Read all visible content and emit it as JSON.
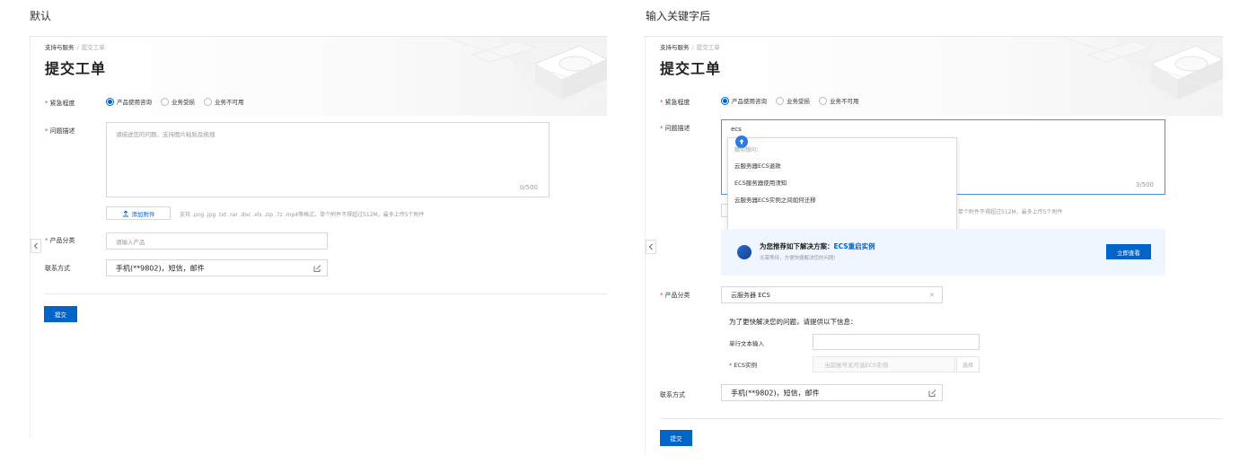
{
  "captions": {
    "left": "默认",
    "right": "输入关键字后"
  },
  "common": {
    "breadcrumb": {
      "root": "支持与服务",
      "sep": "/",
      "current": "提交工单"
    },
    "title": "提交工单",
    "urgency": {
      "label": "紧急程度",
      "options": [
        "产品使用咨询",
        "业务受损",
        "业务不可用"
      ],
      "selected": 0
    },
    "description": {
      "label": "问题描述"
    },
    "attachment": {
      "button_label": "添加附件",
      "hint": "支持 .png .jpg .txt .rar .doc .xls .zip .7z .mp4等格式，单个附件不得超过512M，最多上传5个附件"
    },
    "product": {
      "label": "产品分类",
      "placeholder": "请输入产品"
    },
    "contact": {
      "label": "联系方式",
      "value": "手机(**9802)，短信，邮件"
    },
    "submit_label": "提交",
    "colors": {
      "accent": "#0064c8",
      "required": "#e34",
      "border": "#d7d7d7"
    }
  },
  "left_panel": {
    "description_placeholder": "请描述您的问题，支持图片粘贴及拖拽",
    "description_count": "0/500"
  },
  "right_panel": {
    "description_value": "ecs",
    "description_count": "3/500",
    "attach_hint_visible": "单个附件不得超过512M，最多上传5个附件",
    "dropdown": {
      "group_label": "猜你想问：",
      "items": [
        "云服务器ECS退款",
        "ECS服务器使用须知",
        "云服务器ECS实例之间如何迁移"
      ]
    },
    "recommendation": {
      "title_prefix": "为您推荐如下解决方案：",
      "title_link": "ECS重启实例",
      "subtitle": "无需等待，方便快捷解决您的问题!",
      "button_label": "立即查看"
    },
    "product_value": "云服务器 ECS",
    "extra_info": {
      "title": "为了更快解决您的问题，请提供以下信息：",
      "single_text_label": "单行文本输入",
      "ecs_label": "ECS实例",
      "ecs_placeholder": "当前账号无可选ECS实例",
      "select_label": "选择"
    }
  }
}
